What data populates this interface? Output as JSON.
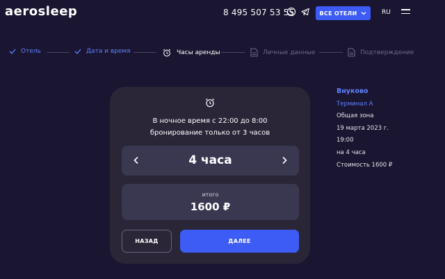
{
  "header": {
    "logo": "aerosleep",
    "phone": "8 495 507 53 55",
    "all_hotels_label": "ВСЕ ОТЕЛИ",
    "lang": "RU"
  },
  "stepper": {
    "steps": [
      {
        "label": "Отель",
        "state": "done"
      },
      {
        "label": "Дата и время",
        "state": "done"
      },
      {
        "label": "Часы аренды",
        "state": "current"
      },
      {
        "label": "Личные данные",
        "state": "todo"
      },
      {
        "label": "Подтверждение",
        "state": "todo"
      }
    ]
  },
  "booking": {
    "notice_line1": "В ночное время с 22:00 до 8:00",
    "notice_line2": "бронирование только от 3 часов",
    "hours": "4 часа",
    "total_label": "итого",
    "total_value": "1600 ₽",
    "back_label": "НАЗАД",
    "next_label": "ДАЛЕЕ"
  },
  "summary": {
    "airport": "Внуково",
    "terminal": "Терминал А",
    "zone": "Общая зона",
    "date": "19 марта 2023 г.",
    "time": "19:00",
    "duration": "на 4 часа",
    "cost": "Стоимость 1600 ₽"
  },
  "colors": {
    "background": "#1a1530",
    "accent": "#3d5cf5",
    "step_done": "#5f83ff",
    "card": "#2a2638"
  }
}
